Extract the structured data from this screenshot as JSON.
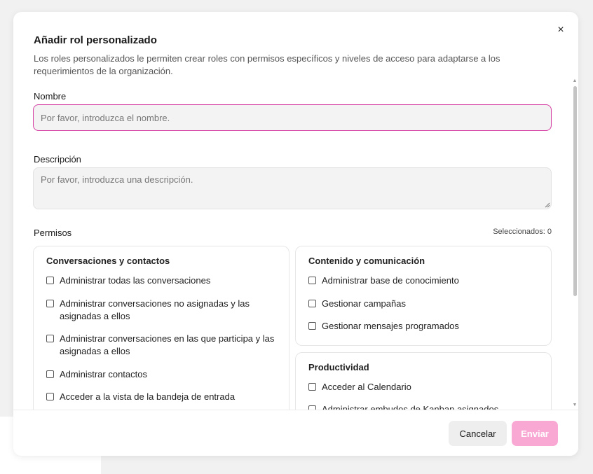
{
  "dialog": {
    "title": "Añadir rol personalizado",
    "subtitle": "Los roles personalizados le permiten crear roles con permisos específicos y niveles de acceso para adaptarse a los requerimientos de la organización.",
    "close_glyph": "×"
  },
  "form": {
    "name_label": "Nombre",
    "name_placeholder": "Por favor, introduzca el nombre.",
    "description_label": "Descripción",
    "description_placeholder": "Por favor, introduzca una descripción.",
    "permissions_label": "Permisos",
    "selected_count": "Seleccionados: 0"
  },
  "groups": {
    "conversations": {
      "title": "Conversaciones y contactos",
      "items": [
        "Administrar todas las conversaciones",
        "Administrar conversaciones no asignadas y las asignadas a ellos",
        "Administrar conversaciones en las que participa y las asignadas a ellos",
        "Administrar contactos",
        "Acceder a la vista de la bandeja de entrada"
      ]
    },
    "content": {
      "title": "Contenido y comunicación",
      "items": [
        "Administrar base de conocimiento",
        "Gestionar campañas",
        "Gestionar mensajes programados"
      ]
    },
    "productivity": {
      "title": "Productividad",
      "items": [
        "Acceder al Calendario",
        "Administrar embudos de Kanban asignados"
      ]
    }
  },
  "footer": {
    "cancel_label": "Cancelar",
    "submit_label": "Enviar"
  },
  "colors": {
    "accent": "#d63fa3",
    "submit_disabled": "#f9a8d4"
  }
}
